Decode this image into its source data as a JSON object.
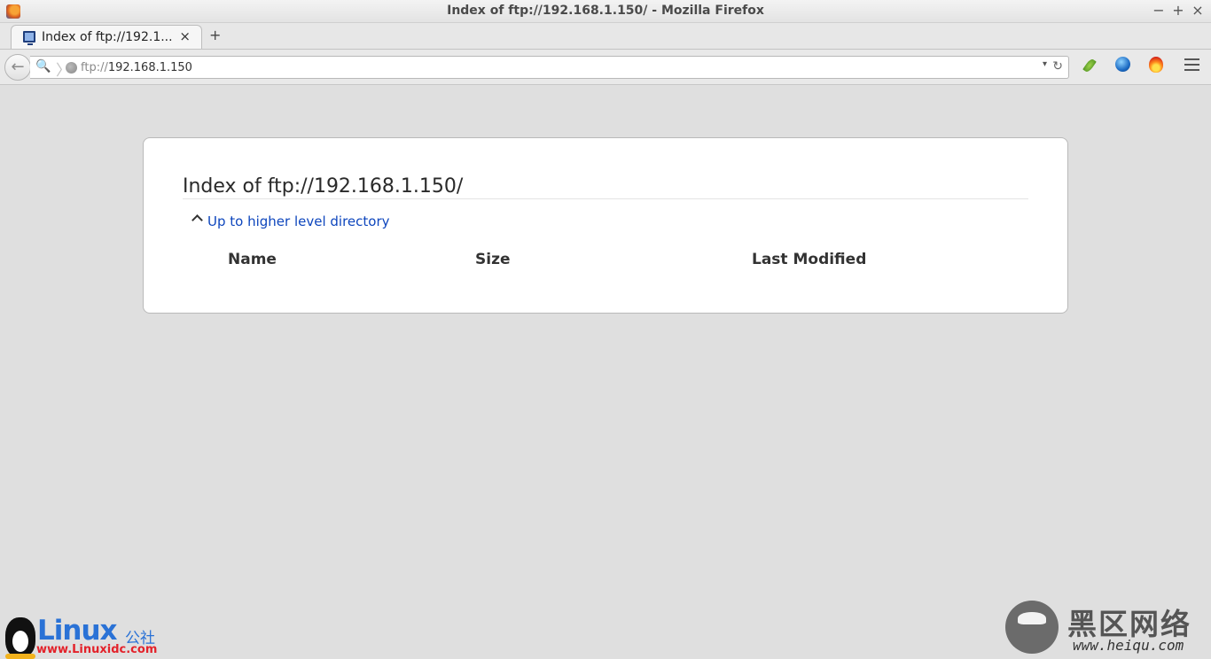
{
  "window": {
    "title": "Index of ftp://192.168.1.150/ - Mozilla Firefox",
    "controls": {
      "minimize": "−",
      "maximize": "+",
      "close": "×"
    }
  },
  "tab": {
    "label": "Index of ftp://192.1...",
    "close": "×",
    "new_tab": "+"
  },
  "navbar": {
    "back": "←",
    "identity": "🔍",
    "url_scheme": "ftp://",
    "url_host": "192.168.1.150",
    "dropmarker": "▾",
    "reload": "↻"
  },
  "page": {
    "heading": "Index of ftp://192.168.1.150/",
    "up_link": "Up to higher level directory",
    "columns": [
      "Name",
      "Size",
      "Last Modified"
    ]
  },
  "watermarks": {
    "left": {
      "word": "Linux",
      "cn": "公社",
      "url": "www.Linuxidc.com"
    },
    "right": {
      "cn": "黑区网络",
      "url": "www.heiqu.com"
    }
  },
  "icons": {
    "app": "firefox-icon",
    "tab_favicon": "monitor-icon",
    "globe": "globe-icon",
    "extensions": [
      "leaf-icon",
      "orb-icon",
      "fire-icon"
    ],
    "menu": "hamburger-menu-icon"
  }
}
